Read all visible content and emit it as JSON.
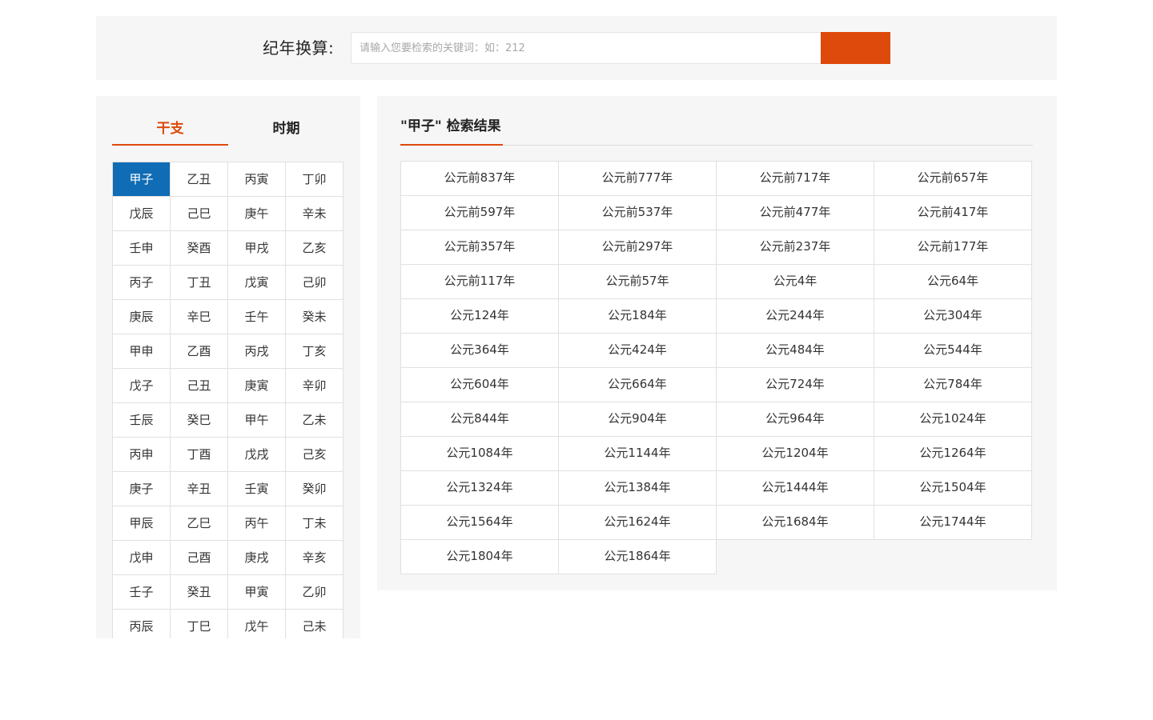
{
  "search": {
    "label": "纪年换算:",
    "placeholder": "请输入您要检索的关键词：如：212",
    "value": "",
    "button_color": "#de4a0c"
  },
  "tabs": [
    {
      "label": "干支",
      "active": true
    },
    {
      "label": "时期",
      "active": false
    }
  ],
  "accent_color": "#de4a0c",
  "selected_color": "#0f6cb5",
  "ganzhi": [
    "甲子",
    "乙丑",
    "丙寅",
    "丁卯",
    "戊辰",
    "己巳",
    "庚午",
    "辛未",
    "壬申",
    "癸酉",
    "甲戌",
    "乙亥",
    "丙子",
    "丁丑",
    "戊寅",
    "己卯",
    "庚辰",
    "辛巳",
    "壬午",
    "癸未",
    "甲申",
    "乙酉",
    "丙戌",
    "丁亥",
    "戊子",
    "己丑",
    "庚寅",
    "辛卯",
    "壬辰",
    "癸巳",
    "甲午",
    "乙未",
    "丙申",
    "丁酉",
    "戊戌",
    "己亥",
    "庚子",
    "辛丑",
    "壬寅",
    "癸卯",
    "甲辰",
    "乙巳",
    "丙午",
    "丁未",
    "戊申",
    "己酉",
    "庚戌",
    "辛亥",
    "壬子",
    "癸丑",
    "甲寅",
    "乙卯",
    "丙辰",
    "丁巳",
    "戊午",
    "己未"
  ],
  "selected_ganzhi": "甲子",
  "result": {
    "title": "\"甲子\" 检索结果",
    "years": [
      "公元前837年",
      "公元前777年",
      "公元前717年",
      "公元前657年",
      "公元前597年",
      "公元前537年",
      "公元前477年",
      "公元前417年",
      "公元前357年",
      "公元前297年",
      "公元前237年",
      "公元前177年",
      "公元前117年",
      "公元前57年",
      "公元4年",
      "公元64年",
      "公元124年",
      "公元184年",
      "公元244年",
      "公元304年",
      "公元364年",
      "公元424年",
      "公元484年",
      "公元544年",
      "公元604年",
      "公元664年",
      "公元724年",
      "公元784年",
      "公元844年",
      "公元904年",
      "公元964年",
      "公元1024年",
      "公元1084年",
      "公元1144年",
      "公元1204年",
      "公元1264年",
      "公元1324年",
      "公元1384年",
      "公元1444年",
      "公元1504年",
      "公元1564年",
      "公元1624年",
      "公元1684年",
      "公元1744年",
      "公元1804年",
      "公元1864年"
    ]
  }
}
